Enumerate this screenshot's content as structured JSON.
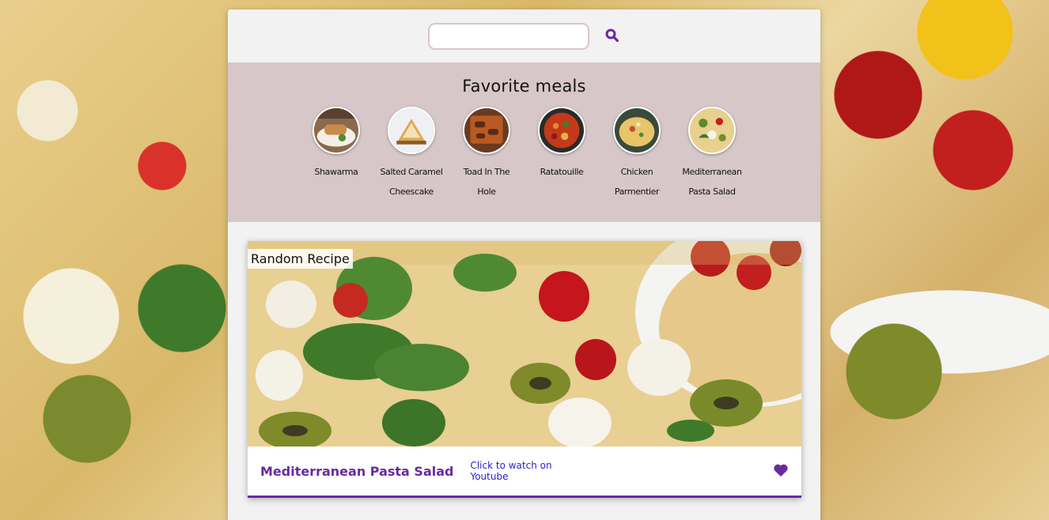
{
  "search": {
    "value": "",
    "placeholder": ""
  },
  "favorites": {
    "title": "Favorite meals",
    "items": [
      {
        "label": "Shawarma"
      },
      {
        "label": "Salted Caramel Cheescake"
      },
      {
        "label": "Toad In The Hole"
      },
      {
        "label": "Ratatouille"
      },
      {
        "label": "Chicken Parmentier"
      },
      {
        "label": "Mediterranean Pasta Salad"
      }
    ]
  },
  "random_meal": {
    "tag": "Random Recipe",
    "name": "Mediterranean Pasta Salad",
    "youtube_link": "Click to watch on Youtube",
    "favorited": true
  },
  "colors": {
    "accent": "#6a2a9e",
    "favorites_bg": "#d7c7c8",
    "link": "#2a1ed0",
    "card_bg": "#f2f2f2"
  },
  "icons": {
    "search": "search-icon",
    "favorite": "heart-icon"
  }
}
